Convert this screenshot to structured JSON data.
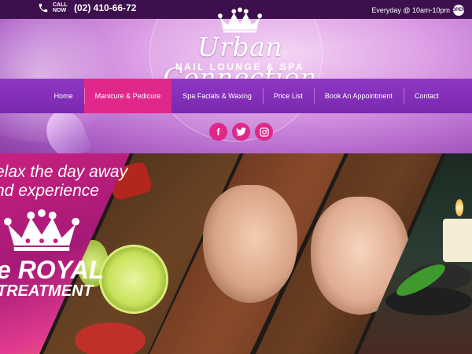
{
  "topbar": {
    "call_label": "CALL NOW",
    "phone": "(02) 410-66-72",
    "hours": "Everyday @ 10am-10pm",
    "badge": "OPEN"
  },
  "logo": {
    "title": "Urban Connection",
    "subtitle": "NAIL LOUNGE & SPA"
  },
  "nav": {
    "items": [
      {
        "label": "Home"
      },
      {
        "label": "Manicure & Pedicure"
      },
      {
        "label": "Spa Facials & Waxing"
      },
      {
        "label": "Price List"
      },
      {
        "label": "Book An Appointment"
      },
      {
        "label": "Contact"
      }
    ],
    "active_index": 1
  },
  "social": {
    "icons": [
      "facebook-icon",
      "twitter-icon",
      "instagram-icon"
    ]
  },
  "hero": {
    "line1": "elax the day away",
    "line2": "nd experience",
    "royal": "e ROYAL",
    "treatment": "TREATMENT"
  },
  "colors": {
    "accent_pink": "#e0288a",
    "nav_purple": "#8e37c4",
    "topbar": "#3d0f4d"
  }
}
